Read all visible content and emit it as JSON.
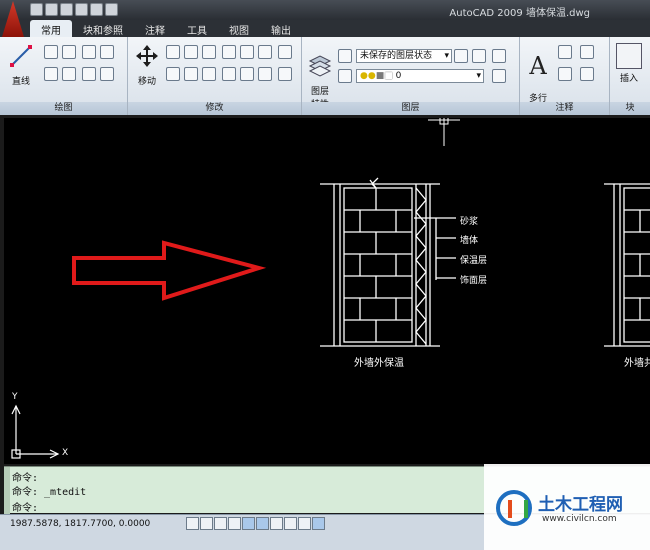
{
  "window": {
    "title": "AutoCAD 2009  墙体保温.dwg"
  },
  "tabs": [
    {
      "label": "常用",
      "active": true
    },
    {
      "label": "块和参照",
      "active": false
    },
    {
      "label": "注释",
      "active": false
    },
    {
      "label": "工具",
      "active": false
    },
    {
      "label": "视图",
      "active": false
    },
    {
      "label": "输出",
      "active": false
    }
  ],
  "ribbon": {
    "draw": {
      "title": "绘图",
      "line_label": "直线"
    },
    "modify": {
      "title": "修改",
      "move_label": "移动"
    },
    "layers": {
      "title": "图层",
      "props_label": "图层\n特性",
      "state_combo": "未保存的图层状态",
      "layer_combo": "0"
    },
    "annotation": {
      "title": "注释",
      "mtext_label": "多行\n文字"
    },
    "block": {
      "insert_label": "插入",
      "title": "块"
    }
  },
  "drawing": {
    "labels": {
      "mortar": "砂浆",
      "wall": "墙体",
      "insulation": "保温层",
      "finish": "饰面层",
      "caption_left": "外墙外保温",
      "caption_right": "外墙共"
    },
    "ucs": {
      "x_label": "X",
      "y_label": "Y"
    },
    "arrow_color": "#e01a1a"
  },
  "command": {
    "lines": [
      "命令:",
      "命令: _mtedit",
      "命令:"
    ]
  },
  "status": {
    "coordinates": "1987.5878, 1817.7700, 0.0000"
  },
  "watermark": {
    "title": "土木工程网",
    "url": "www.civilcn.com"
  }
}
